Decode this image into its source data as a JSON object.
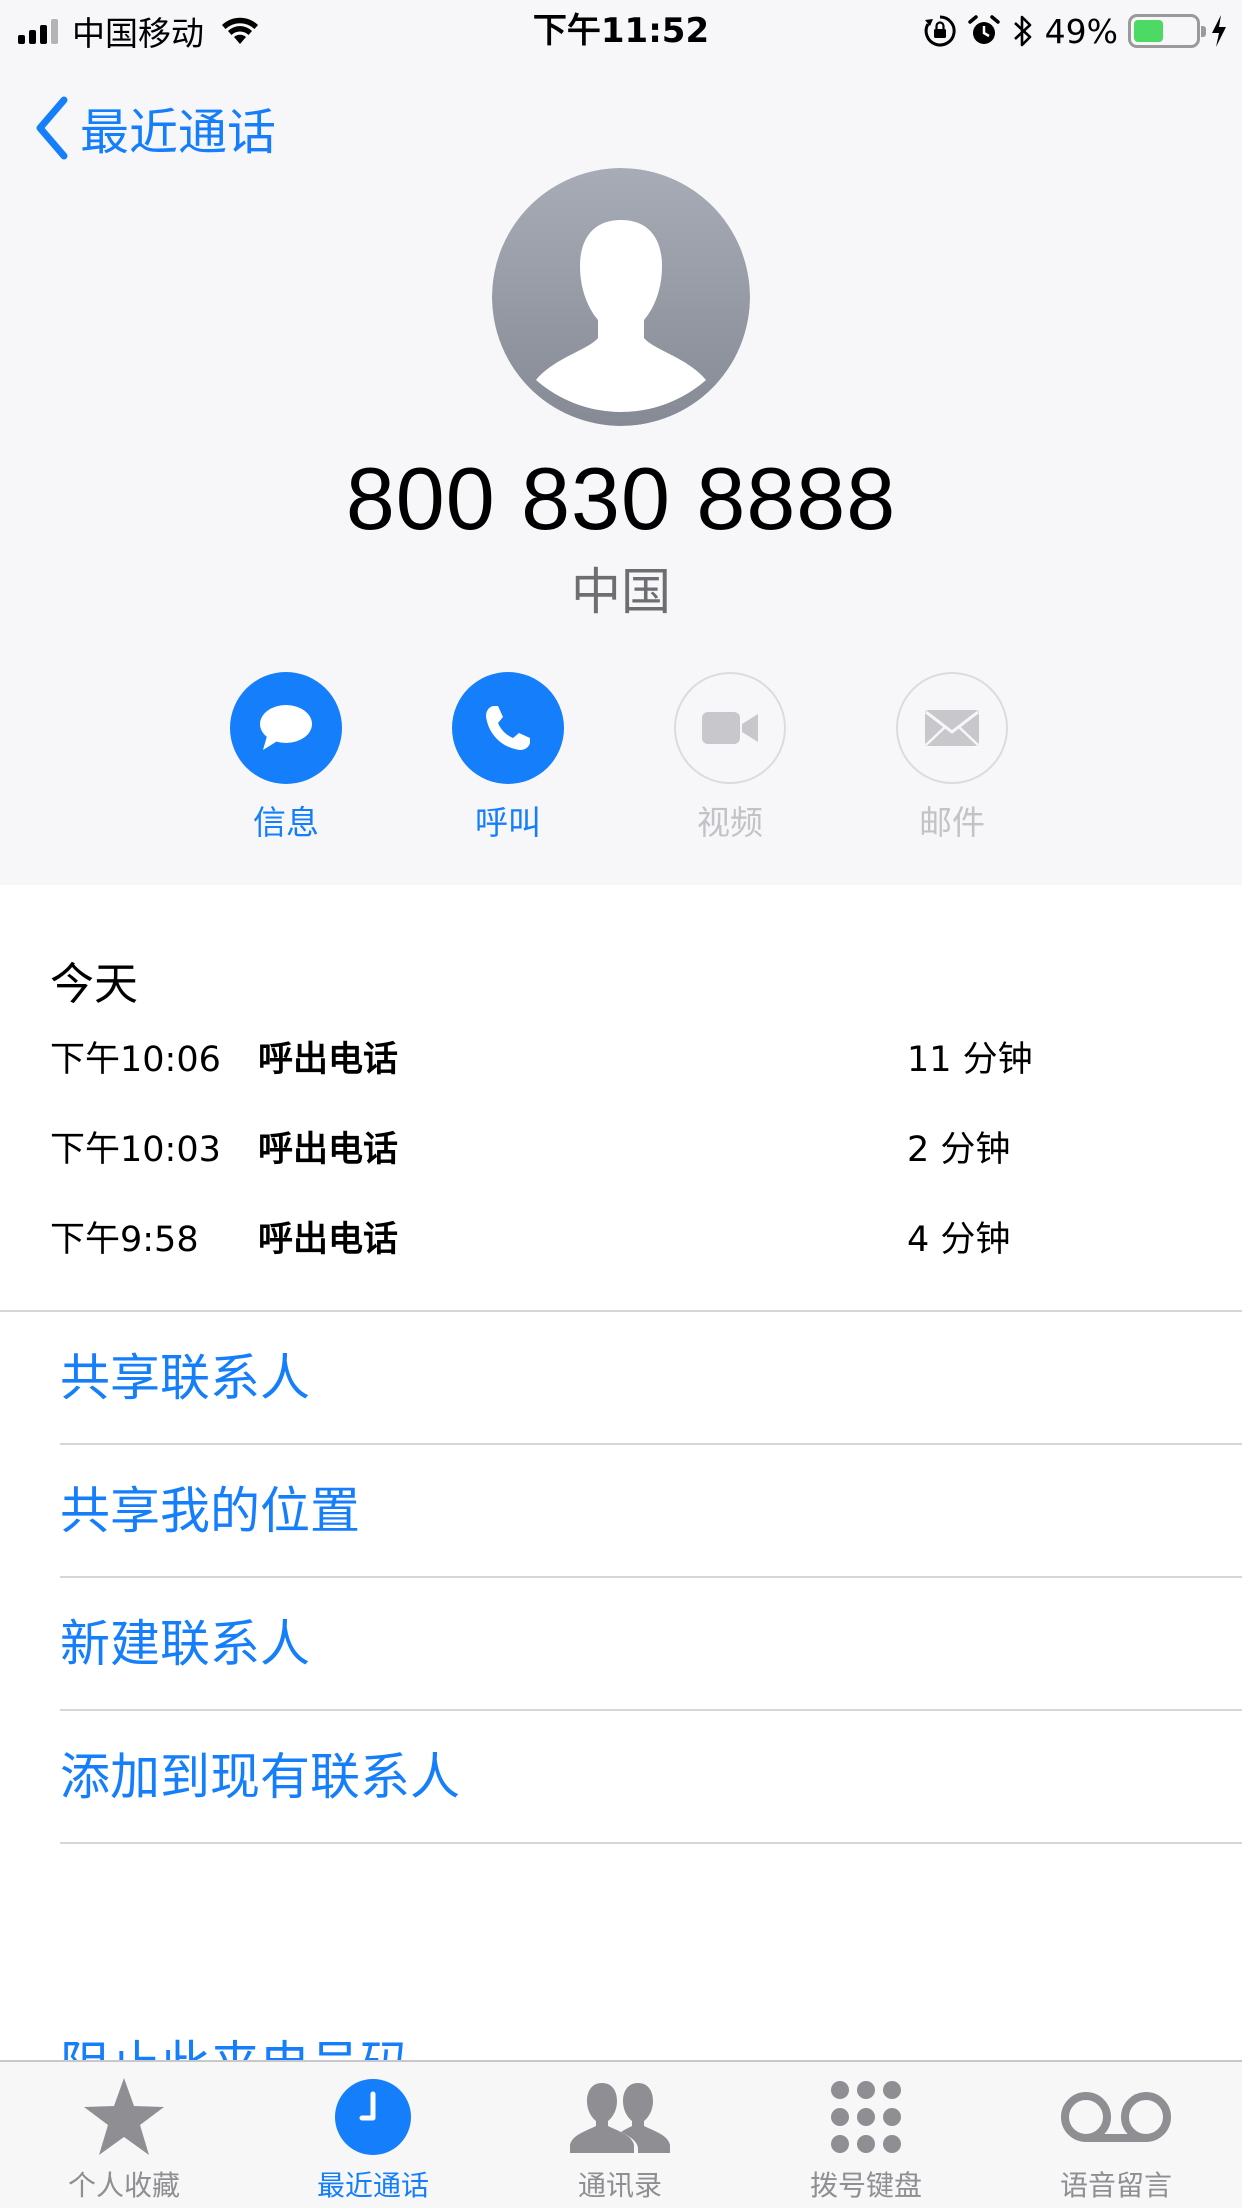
{
  "status_bar": {
    "carrier": "中国移动",
    "time": "下午11:52",
    "battery_percent_text": "49%",
    "battery_level": 0.49
  },
  "nav": {
    "back_label": "最近通话"
  },
  "contact": {
    "phone_number": "800 830 8888",
    "location": "中国"
  },
  "actions": [
    {
      "label": "信息",
      "icon": "message-icon",
      "enabled": true
    },
    {
      "label": "呼叫",
      "icon": "phone-icon",
      "enabled": true
    },
    {
      "label": "视频",
      "icon": "video-icon",
      "enabled": false
    },
    {
      "label": "邮件",
      "icon": "mail-icon",
      "enabled": false
    }
  ],
  "history": {
    "title": "今天",
    "calls": [
      {
        "time": "下午10:06",
        "type": "呼出电话",
        "duration": "11 分钟"
      },
      {
        "time": "下午10:03",
        "type": "呼出电话",
        "duration": "2 分钟"
      },
      {
        "time": "下午9:58",
        "type": "呼出电话",
        "duration": "4 分钟"
      }
    ]
  },
  "options": [
    "共享联系人",
    "共享我的位置",
    "新建联系人",
    "添加到现有联系人"
  ],
  "partial_option": "阻止此来电号码",
  "tabs": [
    {
      "label": "个人收藏",
      "icon": "star-icon",
      "active": false
    },
    {
      "label": "最近通话",
      "icon": "clock-icon",
      "active": true
    },
    {
      "label": "通讯录",
      "icon": "contacts-icon",
      "active": false
    },
    {
      "label": "拨号键盘",
      "icon": "keypad-icon",
      "active": false
    },
    {
      "label": "语音留言",
      "icon": "voicemail-icon",
      "active": false
    }
  ],
  "colors": {
    "accent": "#147efb",
    "battery_green": "#4cd964",
    "inactive_gray": "#c2c2c7",
    "header_bg": "#f7f7f9"
  }
}
